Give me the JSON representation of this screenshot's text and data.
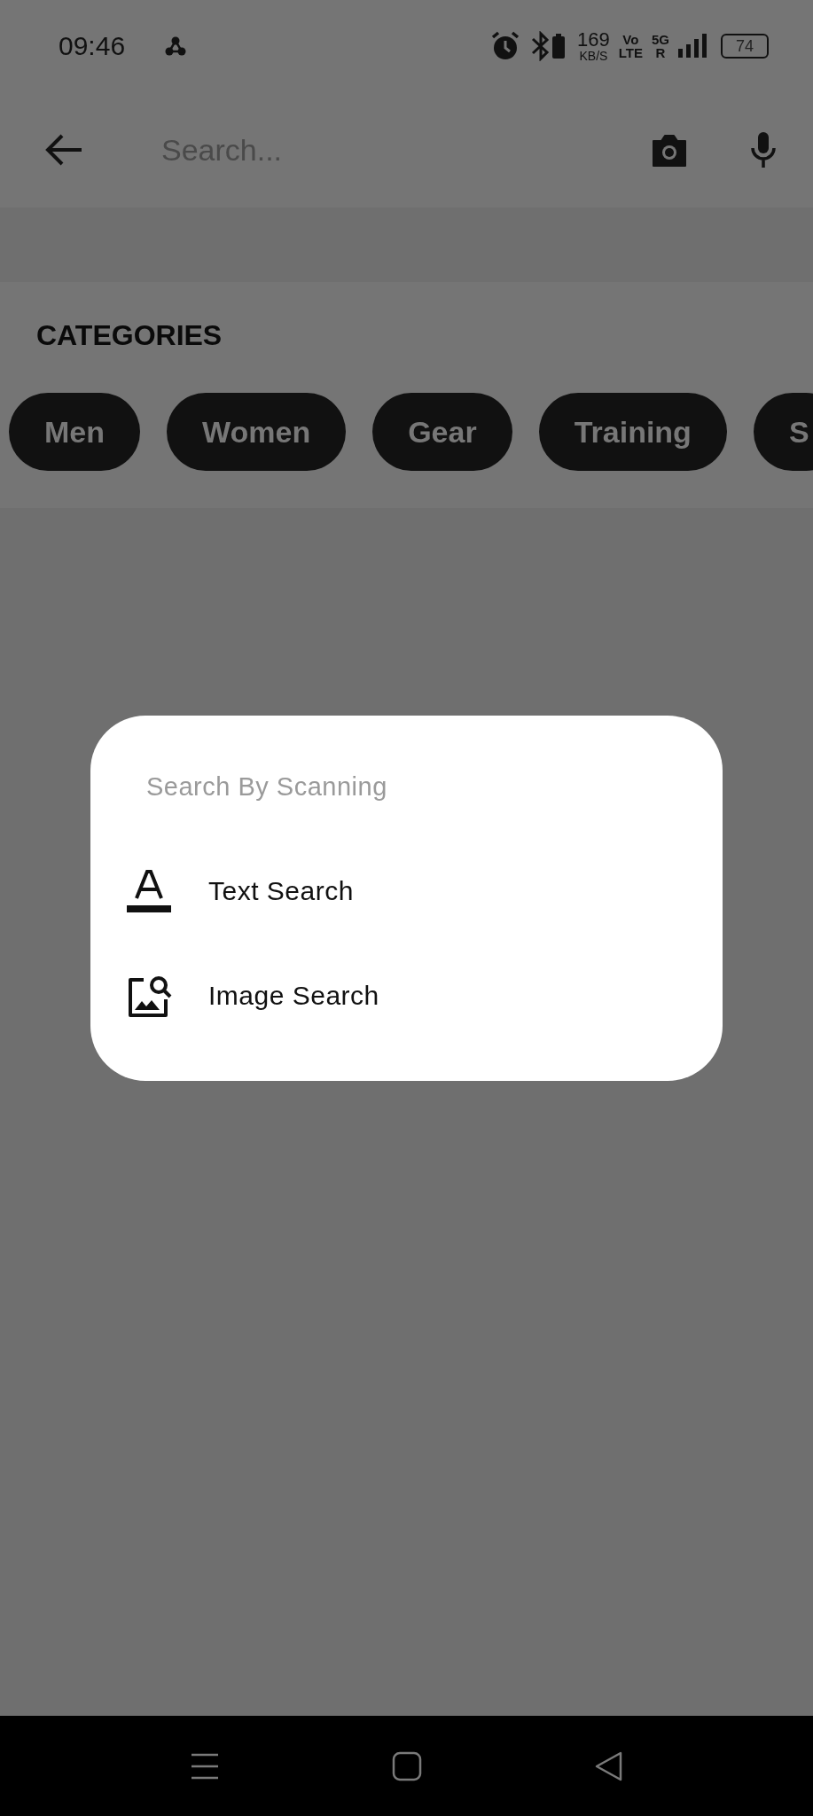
{
  "status_bar": {
    "time": "09:46",
    "speed_value": "169",
    "speed_unit": "KB/S",
    "volte_top": "Vo",
    "volte_bottom": "LTE",
    "network_type": "5G",
    "roaming": "R",
    "battery": "74"
  },
  "search": {
    "placeholder": "Search..."
  },
  "categories": {
    "title": "CATEGORIES",
    "chips": [
      {
        "label": "Men"
      },
      {
        "label": "Women"
      },
      {
        "label": "Gear"
      },
      {
        "label": "Training"
      },
      {
        "label": "S"
      }
    ]
  },
  "dialog": {
    "title": "Search By Scanning",
    "options": [
      {
        "label": "Text Search",
        "kind": "text"
      },
      {
        "label": "Image Search",
        "kind": "image"
      }
    ]
  }
}
